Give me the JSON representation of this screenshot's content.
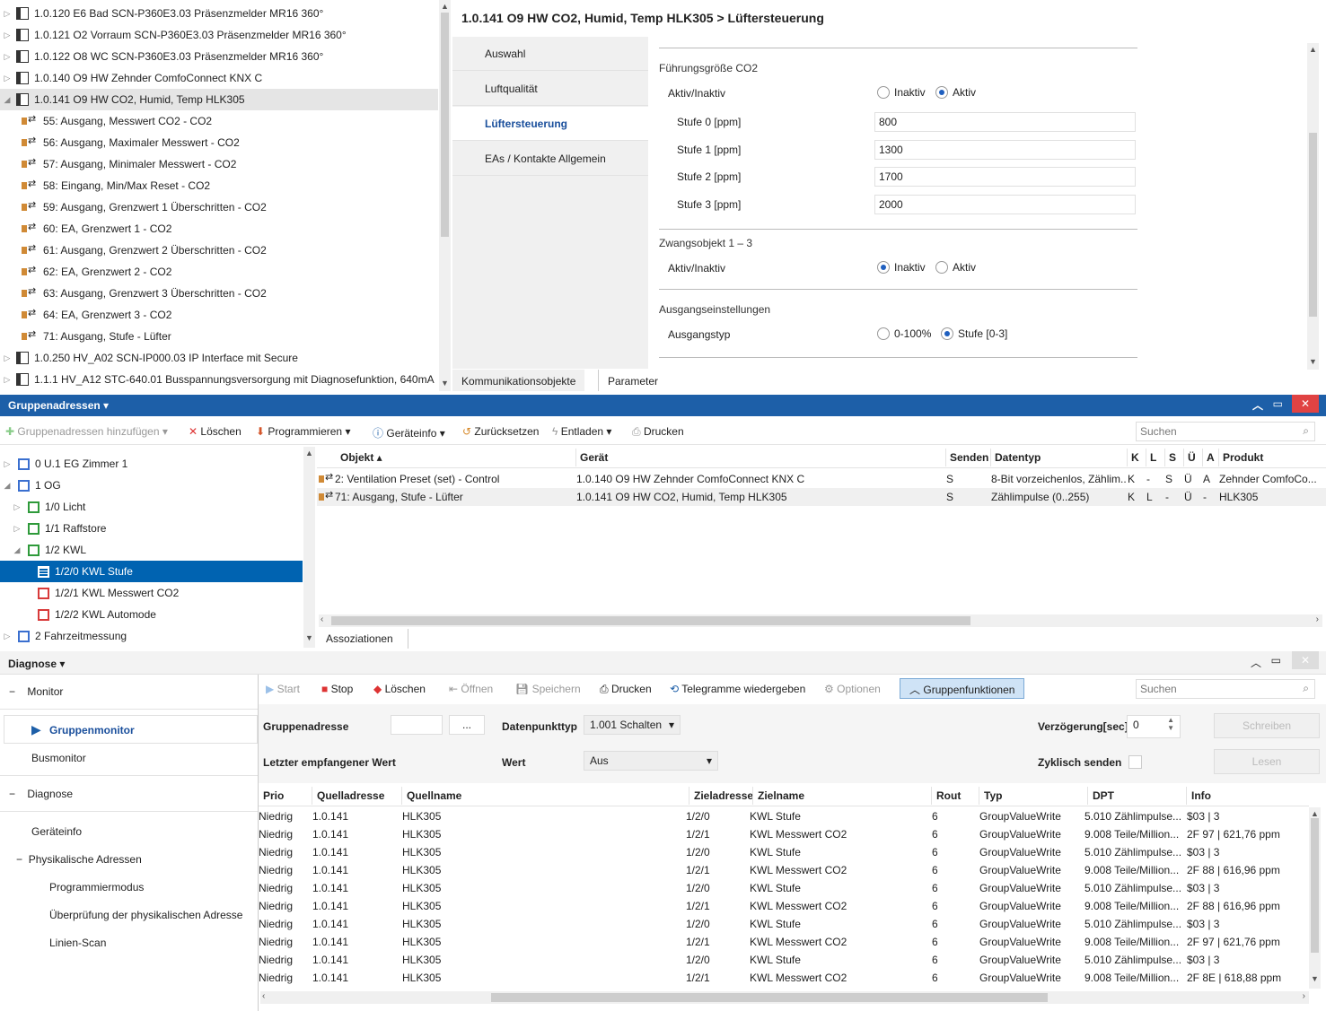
{
  "tree": {
    "items": [
      {
        "label": "1.0.120 E6 Bad SCN-P360E3.03 Präsenzmelder MR16 360°",
        "kind": "device",
        "expander": "▷"
      },
      {
        "label": "1.0.121 O2 Vorraum SCN-P360E3.03 Präsenzmelder MR16 360°",
        "kind": "device",
        "expander": "▷"
      },
      {
        "label": "1.0.122 O8 WC SCN-P360E3.03 Präsenzmelder MR16 360°",
        "kind": "device",
        "expander": "▷"
      },
      {
        "label": "1.0.140 O9 HW Zehnder ComfoConnect KNX C",
        "kind": "device",
        "expander": "▷"
      },
      {
        "label": "1.0.141 O9 HW CO2, Humid, Temp HLK305",
        "kind": "device",
        "expander": "◢",
        "selected": true
      },
      {
        "label": "55: Ausgang, Messwert CO2 - CO2",
        "kind": "object"
      },
      {
        "label": "56: Ausgang, Maximaler Messwert  - CO2",
        "kind": "object"
      },
      {
        "label": "57: Ausgang, Minimaler Messwert  - CO2",
        "kind": "object"
      },
      {
        "label": "58: Eingang, Min/Max Reset - CO2",
        "kind": "object"
      },
      {
        "label": "59: Ausgang, Grenzwert 1 Überschritten - CO2",
        "kind": "object"
      },
      {
        "label": "60: EA, Grenzwert 1 - CO2",
        "kind": "object"
      },
      {
        "label": "61: Ausgang, Grenzwert 2 Überschritten - CO2",
        "kind": "object"
      },
      {
        "label": "62: EA, Grenzwert 2 - CO2",
        "kind": "object"
      },
      {
        "label": "63: Ausgang, Grenzwert 3 Überschritten - CO2",
        "kind": "object"
      },
      {
        "label": "64: EA, Grenzwert 3 - CO2",
        "kind": "object"
      },
      {
        "label": "71: Ausgang, Stufe - Lüfter",
        "kind": "object"
      },
      {
        "label": "1.0.250 HV_A02 SCN-IP000.03 IP Interface mit Secure",
        "kind": "device",
        "expander": "▷"
      },
      {
        "label": "1.1.1 HV_A12 STC-640.01 Busspannungsversorgung mit Diagnosefunktion, 640mA",
        "kind": "device",
        "expander": "▷"
      }
    ]
  },
  "params": {
    "title": "1.0.141 O9 HW CO2, Humid, Temp HLK305 > Lüftersteuerung",
    "tabs": [
      "Auswahl",
      "Luftqualität",
      "Lüftersteuerung",
      "EAs / Kontakte Allgemein"
    ],
    "active_tab": "Lüftersteuerung",
    "sec1": "Führungsgröße CO2",
    "sec1_toggle_label": "Aktiv/Inaktiv",
    "inaktiv": "Inaktiv",
    "aktiv": "Aktiv",
    "fields": [
      {
        "label": "Stufe 0 [ppm]",
        "value": "800"
      },
      {
        "label": "Stufe 1 [ppm]",
        "value": "1300"
      },
      {
        "label": "Stufe 2 [ppm]",
        "value": "1700"
      },
      {
        "label": "Stufe 3 [ppm]",
        "value": "2000"
      }
    ],
    "sec2": "Zwangsobjekt 1 – 3",
    "sec2_toggle_label": "Aktiv/Inaktiv",
    "sec3": "Ausgangseinstellungen",
    "sec3_label": "Ausgangstyp",
    "opt_percent": "0-100%",
    "opt_stufe": "Stufe [0-3]",
    "bottom_tabs": [
      "Kommunikationsobjekte",
      "Parameter"
    ]
  },
  "gruppen": {
    "title": "Gruppenadressen ▾",
    "toolbar": {
      "add": "Gruppenadressen hinzufügen",
      "delete": "Löschen",
      "program": "Programmieren",
      "info": "Geräteinfo",
      "reset": "Zurücksetzen",
      "unload": "Entladen",
      "print": "Drucken",
      "search": "Suchen"
    },
    "tree": [
      {
        "label": "0 U.1 EG Zimmer 1",
        "indent": 0,
        "color": "b",
        "exp": "▷"
      },
      {
        "label": "1 OG",
        "indent": 0,
        "color": "b",
        "exp": "◢"
      },
      {
        "label": "1/0 Licht",
        "indent": 1,
        "color": "g",
        "exp": "▷"
      },
      {
        "label": "1/1 Raffstore",
        "indent": 1,
        "color": "g",
        "exp": "▷"
      },
      {
        "label": "1/2 KWL",
        "indent": 1,
        "color": "g",
        "exp": "◢"
      },
      {
        "label": "1/2/0 KWL Stufe",
        "indent": 2,
        "color": "r",
        "exp": "",
        "selected": true
      },
      {
        "label": "1/2/1 KWL Messwert CO2",
        "indent": 2,
        "color": "r",
        "exp": ""
      },
      {
        "label": "1/2/2 KWL Automode",
        "indent": 2,
        "color": "r",
        "exp": ""
      },
      {
        "label": "2 Fahrzeitmessung",
        "indent": 0,
        "color": "b",
        "exp": "▷"
      }
    ],
    "headers": [
      "Objekt ▴",
      "Gerät",
      "Senden",
      "Datentyp",
      "K",
      "L",
      "S",
      "Ü",
      "A",
      "Produkt"
    ],
    "rows": [
      [
        "2: Ventilation Preset (set) - Control",
        "1.0.140 O9 HW Zehnder ComfoConnect KNX C",
        "S",
        "8-Bit vorzeichenlos, Zählim...",
        "K",
        "-",
        "S",
        "Ü",
        "A",
        "Zehnder ComfoCo..."
      ],
      [
        "71: Ausgang, Stufe - Lüfter",
        "1.0.141 O9 HW CO2, Humid, Temp HLK305",
        "S",
        "Zählimpulse (0..255)",
        "K",
        "L",
        "-",
        "Ü",
        "-",
        "HLK305"
      ]
    ],
    "bottom_tab": "Assoziationen"
  },
  "diagnose": {
    "title": "Diagnose ▾",
    "nav": {
      "monitor": "Monitor",
      "gruppenmonitor": "Gruppenmonitor",
      "busmonitor": "Busmonitor",
      "diagnose": "Diagnose",
      "geraeteinfo": "Geräteinfo",
      "phys": "Physikalische Adressen",
      "prog": "Programmiermodus",
      "check": "Überprüfung der physikalischen Adresse",
      "scan": "Linien-Scan"
    },
    "toolbar": {
      "start": "Start",
      "stop": "Stop",
      "delete": "Löschen",
      "open": "Öffnen",
      "save": "Speichern",
      "print": "Drucken",
      "replay": "Telegramme wiedergeben",
      "options": "Optionen",
      "groupfn": "Gruppenfunktionen",
      "search": "Suchen"
    },
    "form": {
      "ga_label": "Gruppenadresse",
      "browse": "...",
      "dpt_label": "Datenpunkttyp",
      "dpt_value": "1.001 Schalten",
      "delay_label": "Verzögerung[sec]",
      "delay_value": "0",
      "write": "Schreiben",
      "last_label": "Letzter empfangener Wert",
      "wert_label": "Wert",
      "wert_value": "Aus",
      "cyclic_label": "Zyklisch senden",
      "read": "Lesen"
    },
    "headers": [
      "Prio",
      "Quelladresse",
      "Quellname",
      "Zieladresse",
      "Zielname",
      "Rout",
      "Typ",
      "DPT",
      "Info"
    ],
    "rows": [
      [
        "Niedrig",
        "1.0.141",
        "HLK305",
        "1/2/0",
        "KWL Stufe",
        "6",
        "GroupValueWrite",
        "5.010 Zählimpulse...",
        "$03 | 3"
      ],
      [
        "Niedrig",
        "1.0.141",
        "HLK305",
        "1/2/1",
        "KWL Messwert CO2",
        "6",
        "GroupValueWrite",
        "9.008 Teile/Million...",
        "2F 97 | 621,76 ppm"
      ],
      [
        "Niedrig",
        "1.0.141",
        "HLK305",
        "1/2/0",
        "KWL Stufe",
        "6",
        "GroupValueWrite",
        "5.010 Zählimpulse...",
        "$03 | 3"
      ],
      [
        "Niedrig",
        "1.0.141",
        "HLK305",
        "1/2/1",
        "KWL Messwert CO2",
        "6",
        "GroupValueWrite",
        "9.008 Teile/Million...",
        "2F 88 | 616,96 ppm"
      ],
      [
        "Niedrig",
        "1.0.141",
        "HLK305",
        "1/2/0",
        "KWL Stufe",
        "6",
        "GroupValueWrite",
        "5.010 Zählimpulse...",
        "$03 | 3"
      ],
      [
        "Niedrig",
        "1.0.141",
        "HLK305",
        "1/2/1",
        "KWL Messwert CO2",
        "6",
        "GroupValueWrite",
        "9.008 Teile/Million...",
        "2F 88 | 616,96 ppm"
      ],
      [
        "Niedrig",
        "1.0.141",
        "HLK305",
        "1/2/0",
        "KWL Stufe",
        "6",
        "GroupValueWrite",
        "5.010 Zählimpulse...",
        "$03 | 3"
      ],
      [
        "Niedrig",
        "1.0.141",
        "HLK305",
        "1/2/1",
        "KWL Messwert CO2",
        "6",
        "GroupValueWrite",
        "9.008 Teile/Million...",
        "2F 97 | 621,76 ppm"
      ],
      [
        "Niedrig",
        "1.0.141",
        "HLK305",
        "1/2/0",
        "KWL Stufe",
        "6",
        "GroupValueWrite",
        "5.010 Zählimpulse...",
        "$03 | 3"
      ],
      [
        "Niedrig",
        "1.0.141",
        "HLK305",
        "1/2/1",
        "KWL Messwert CO2",
        "6",
        "GroupValueWrite",
        "9.008 Teile/Million...",
        "2F 8E | 618,88 ppm"
      ]
    ]
  },
  "colors": {
    "accent": "#1d5fa8",
    "selection": "#0063b1",
    "close": "#e04343"
  }
}
